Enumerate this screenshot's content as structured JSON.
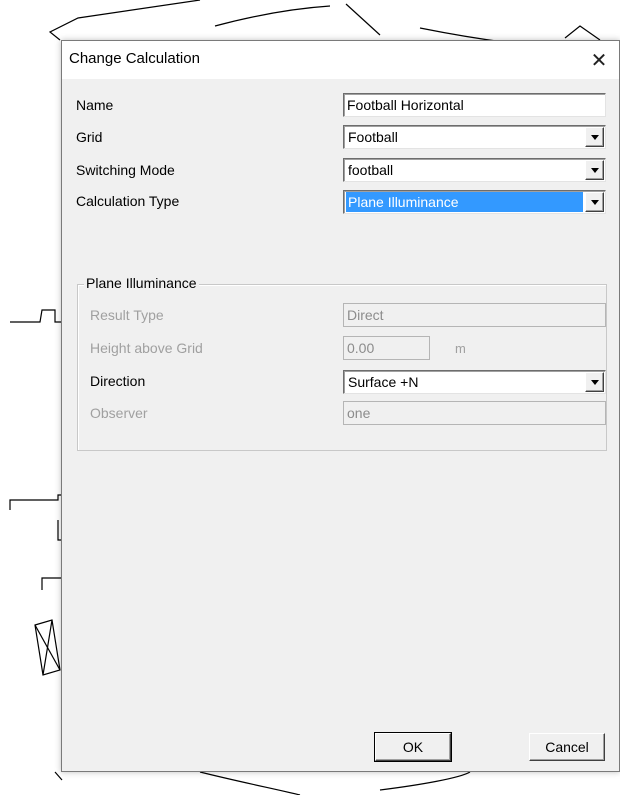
{
  "dialog": {
    "title": "Change Calculation",
    "close_glyph": "✕"
  },
  "form": {
    "name_label": "Name",
    "name_value": "Football Horizontal",
    "grid_label": "Grid",
    "grid_value": "Football",
    "switching_label": "Switching Mode",
    "switching_value": "football",
    "calc_type_label": "Calculation Type",
    "calc_type_value": "Plane Illuminance"
  },
  "group": {
    "title": "Plane Illuminance",
    "result_type_label": "Result Type",
    "result_type_value": "Direct",
    "height_label": "Height above Grid",
    "height_value": "0.00",
    "height_unit": "m",
    "direction_label": "Direction",
    "direction_value": "Surface +N",
    "observer_label": "Observer",
    "observer_value": "one"
  },
  "buttons": {
    "ok": "OK",
    "cancel": "Cancel"
  },
  "colors": {
    "selection": "#3399ff",
    "dialog_bg": "#f0f0f0",
    "disabled_text": "#a0a0a0"
  }
}
